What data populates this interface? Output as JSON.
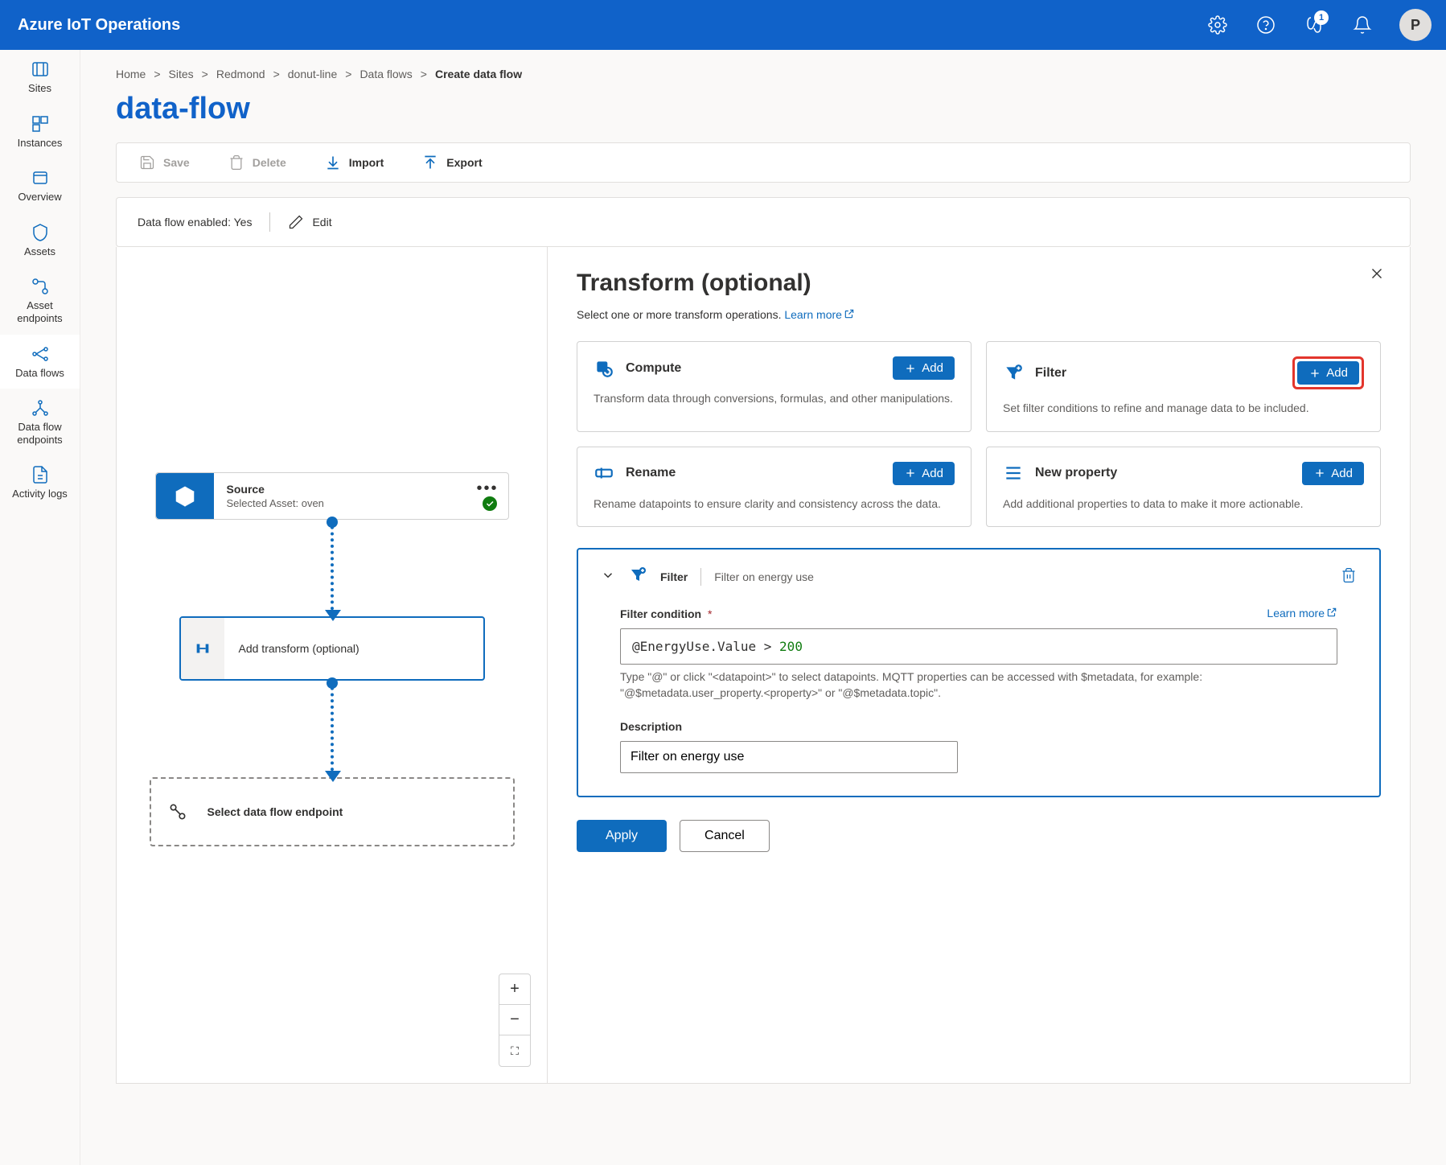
{
  "header": {
    "title": "Azure IoT Operations",
    "notif_badge": "1",
    "avatar_initial": "P"
  },
  "sidebar": {
    "items": [
      {
        "label": "Sites"
      },
      {
        "label": "Instances"
      },
      {
        "label": "Overview"
      },
      {
        "label": "Assets"
      },
      {
        "label": "Asset endpoints"
      },
      {
        "label": "Data flows"
      },
      {
        "label": "Data flow endpoints"
      },
      {
        "label": "Activity logs"
      }
    ]
  },
  "breadcrumb": {
    "home": "Home",
    "sites": "Sites",
    "redmond": "Redmond",
    "donut": "donut-line",
    "dataflows": "Data flows",
    "current": "Create data flow"
  },
  "page_title": "data-flow",
  "toolbar": {
    "save": "Save",
    "delete": "Delete",
    "import": "Import",
    "export": "Export"
  },
  "status": {
    "enabled_label": "Data flow enabled: Yes",
    "edit": "Edit"
  },
  "canvas": {
    "source_title": "Source",
    "source_sub": "Selected Asset: oven",
    "transform_label": "Add transform (optional)",
    "endpoint_label": "Select data flow endpoint"
  },
  "panel": {
    "title": "Transform (optional)",
    "subtitle": "Select one or more transform operations. ",
    "learn_more": "Learn more",
    "cards": {
      "compute": {
        "title": "Compute",
        "add": "Add",
        "desc": "Transform data through conversions, formulas, and other manipulations."
      },
      "filter": {
        "title": "Filter",
        "add": "Add",
        "desc": "Set filter conditions to refine and manage data to be included."
      },
      "rename": {
        "title": "Rename",
        "add": "Add",
        "desc": "Rename datapoints to ensure clarity and consistency across the data."
      },
      "newprop": {
        "title": "New property",
        "add": "Add",
        "desc": "Add additional properties to data to make it more actionable."
      }
    },
    "config": {
      "type_label": "Filter",
      "type_sub": "Filter on energy use",
      "field_label": "Filter condition",
      "learn_more": "Learn more",
      "expr_var": "@EnergyUse.Value",
      "expr_op": ">",
      "expr_num": "200",
      "hint": "Type \"@\" or click \"<datapoint>\" to select datapoints. MQTT properties can be accessed with $metadata, for example: \"@$metadata.user_property.<property>\" or \"@$metadata.topic\".",
      "desc_label": "Description",
      "desc_value": "Filter on energy use"
    },
    "footer": {
      "apply": "Apply",
      "cancel": "Cancel"
    }
  }
}
